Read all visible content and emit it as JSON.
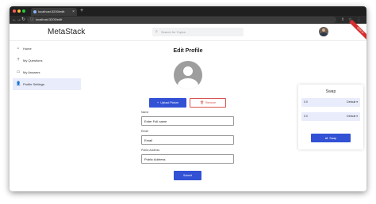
{
  "browser": {
    "tab_title": "localhost:3200/edit",
    "tab_close": "×",
    "new_tab": "+",
    "url": "localhost:3200/edit",
    "back_icon": "←",
    "forward_icon": "→",
    "reload_icon": "↻",
    "lock_icon": "ⓘ",
    "share_icon": "⇪",
    "star_icon": "☆",
    "menu_icon": "⋮"
  },
  "header": {
    "brand": "MetaStack",
    "search_placeholder": "Search for Topics",
    "search_icon": "⌕",
    "ribbon": "DEBUG"
  },
  "sidebar": {
    "items": [
      {
        "label": "Home",
        "icon": "⌂",
        "active": false
      },
      {
        "label": "My Questions",
        "icon": "?",
        "active": false
      },
      {
        "label": "My Answers",
        "icon": "▭",
        "active": false
      },
      {
        "label": "Profile Settings",
        "icon": "👤",
        "active": true
      }
    ]
  },
  "main": {
    "title": "Edit Profile",
    "upload_label": "Upload Picture",
    "upload_icon": "+",
    "remove_label": "Remove",
    "remove_icon": "🗑",
    "fields": {
      "name": {
        "label": "Name",
        "placeholder": "Enter Full name"
      },
      "email": {
        "label": "Email",
        "placeholder": "Email"
      },
      "address": {
        "label": "Public Address",
        "placeholder": "Public Address"
      }
    },
    "submit_label": "Submit"
  },
  "swap": {
    "title": "Swap",
    "rows": [
      {
        "value": "0.0",
        "select": "Default ▾"
      },
      {
        "value": "0.0",
        "select": "Default ▾"
      }
    ],
    "button_label": "Swap",
    "button_icon": "⇄"
  },
  "colors": {
    "accent": "#3251d4",
    "danger": "#d9534f",
    "active_bg": "#e8ecfb"
  }
}
